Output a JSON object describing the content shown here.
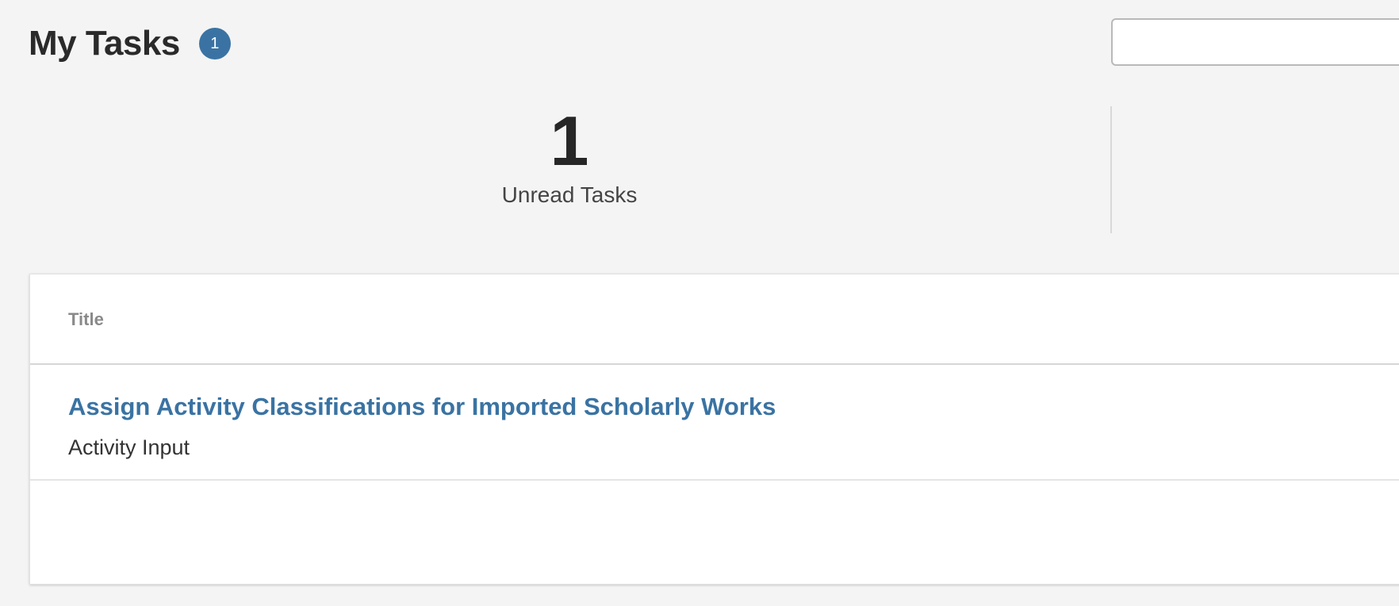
{
  "header": {
    "title": "My Tasks",
    "badge_count": "1"
  },
  "search": {
    "value": "",
    "placeholder": ""
  },
  "stats": {
    "unread_count": "1",
    "unread_label": "Unread Tasks"
  },
  "table": {
    "columns": [
      "Title"
    ],
    "rows": [
      {
        "title": "Assign Activity Classifications for Imported Scholarly Works",
        "subtitle": "Activity Input"
      }
    ]
  },
  "colors": {
    "accent": "#3a73a3",
    "background": "#f4f4f4"
  }
}
